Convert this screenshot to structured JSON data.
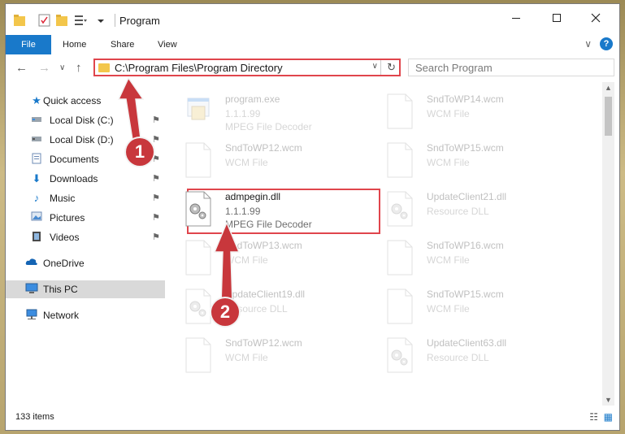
{
  "window": {
    "title": "Program",
    "controls": [
      "minimize",
      "maximize",
      "close"
    ]
  },
  "ribbon": {
    "file_tab": "File",
    "tabs": [
      "Home",
      "Share",
      "View"
    ],
    "help": "?"
  },
  "address": {
    "path": "C:\\Program Files\\Program Directory",
    "search_placeholder": "Search Program"
  },
  "nav_pane": {
    "items": [
      {
        "label": "Quick access",
        "icon": "star-icon"
      },
      {
        "label": "Local Disk (C:)",
        "icon": "drive-icon",
        "pinned": true
      },
      {
        "label": "Local Disk (D:)",
        "icon": "drive-icon",
        "pinned": true
      },
      {
        "label": "Documents",
        "icon": "documents-icon",
        "pinned": true
      },
      {
        "label": "Downloads",
        "icon": "download-icon",
        "pinned": true
      },
      {
        "label": "Music",
        "icon": "music-icon",
        "pinned": true
      },
      {
        "label": "Pictures",
        "icon": "pictures-icon",
        "pinned": true
      },
      {
        "label": "Videos",
        "icon": "video-icon",
        "pinned": true
      },
      {
        "label": "OneDrive",
        "icon": "cloud-icon"
      },
      {
        "label": "This PC",
        "icon": "pc-icon",
        "selected": true
      },
      {
        "label": "Network",
        "icon": "network-icon"
      }
    ]
  },
  "files": {
    "left": [
      {
        "name": "program.exe",
        "line2": "1.1.1.99",
        "line3": "MPEG File Decoder",
        "kind": "exe"
      },
      {
        "name": "SndToWP12.wcm",
        "line2": "WCM File",
        "line3": "",
        "kind": "doc"
      },
      {
        "name": "admpegin.dll",
        "line2": "1.1.1.99",
        "line3": "MPEG File Decoder",
        "kind": "dll"
      },
      {
        "name": "SndToWP13.wcm",
        "line2": "WCM File",
        "line3": "",
        "kind": "doc"
      },
      {
        "name": "UpdateClient19.dll",
        "line2": "Resource DLL",
        "line3": "",
        "kind": "dll"
      },
      {
        "name": "SndToWP12.wcm",
        "line2": "WCM File",
        "line3": "",
        "kind": "doc"
      }
    ],
    "right": [
      {
        "name": "SndToWP14.wcm",
        "line2": "WCM File",
        "line3": "",
        "kind": "doc"
      },
      {
        "name": "SndToWP15.wcm",
        "line2": "WCM File",
        "line3": "",
        "kind": "doc"
      },
      {
        "name": "UpdateClient21.dll",
        "line2": "Resource DLL",
        "line3": "",
        "kind": "dll"
      },
      {
        "name": "SndToWP16.wcm",
        "line2": "WCM File",
        "line3": "",
        "kind": "doc"
      },
      {
        "name": "SndToWP15.wcm",
        "line2": "WCM File",
        "line3": "",
        "kind": "doc"
      },
      {
        "name": "UpdateClient63.dll",
        "line2": "Resource DLL",
        "line3": "",
        "kind": "dll"
      }
    ]
  },
  "status": {
    "count": "133 items"
  },
  "callouts": [
    "1",
    "2"
  ],
  "colors": {
    "accent": "#1979ca",
    "highlight": "#e0454c",
    "callout": "#c8373c",
    "folder": "#f3c64b"
  }
}
